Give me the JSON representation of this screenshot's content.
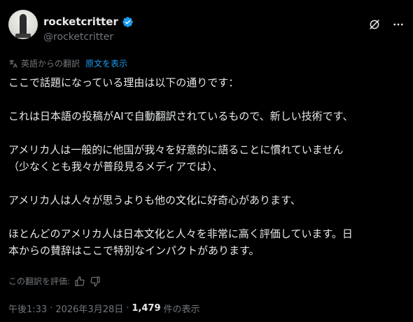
{
  "author": {
    "display_name": "rocketcritter",
    "handle": "@rocketcritter"
  },
  "translation": {
    "label": "英語からの翻訳",
    "show_original": "原文を表示"
  },
  "body": {
    "paragraphs": [
      "ここで話題になっている理由は以下の通りです：",
      "これは日本語の投稿がAIで自動翻訳されているもので、新しい技術です、",
      "アメリカ人は一般的に他国が我々を好意的に語ることに慣れていません\n（少なくとも我々が普段見るメディアでは）、",
      "アメリカ人は人々が思うよりも他の文化に好奇心があります、",
      "ほとんどのアメリカ人は日本文化と人々を非常に高く評価しています。日\n本からの賛辞はここで特別なインパクトがあります。"
    ]
  },
  "rating": {
    "label": "この翻訳を評価:"
  },
  "meta": {
    "time": "午後1:33",
    "sep1": "·",
    "date": "2026年3月28日",
    "sep2": "·",
    "views_count": "1,479",
    "views_label": "件の表示"
  },
  "colors": {
    "background": "#000000",
    "text": "#e7e9ea",
    "muted": "#71767b",
    "link": "#1d9bf0",
    "verified": "#1d9bf0"
  },
  "icons": [
    "verified-badge-icon",
    "grok-icon",
    "more-icon",
    "translate-icon",
    "thumbs-up-icon",
    "thumbs-down-icon"
  ]
}
